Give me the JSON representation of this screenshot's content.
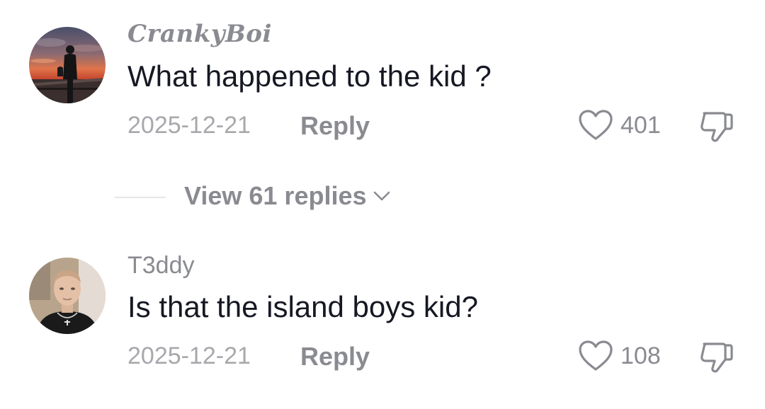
{
  "comments": [
    {
      "username": "CrankyBoi",
      "text": "What happened to the kid ?",
      "date": "2025-12-21",
      "reply_label": "Reply",
      "likes": "401",
      "avatar_icon": "sunset-silhouette-avatar"
    },
    {
      "username": "T3ddy",
      "text": "Is that the island boys kid?",
      "date": "2025-12-21",
      "reply_label": "Reply",
      "likes": "108",
      "avatar_icon": "person-photo-avatar"
    }
  ],
  "view_replies": {
    "label": "View 61 replies"
  },
  "colors": {
    "primary_text": "#161823",
    "secondary_text": "#8a8b91",
    "muted_text": "#a8a8ad"
  }
}
